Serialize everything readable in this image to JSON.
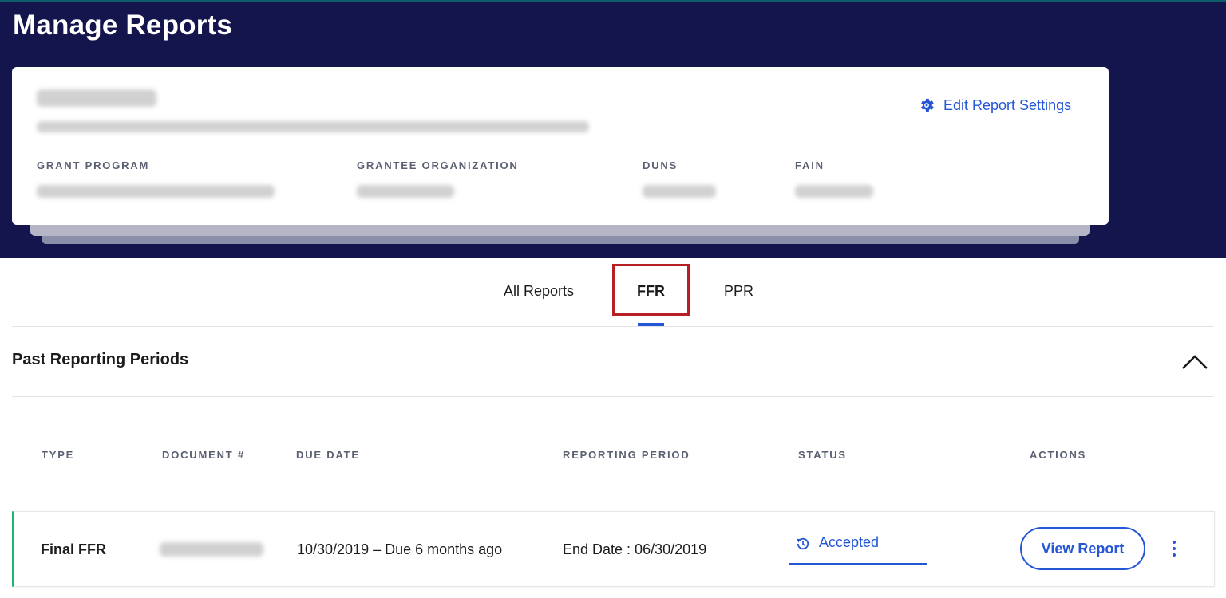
{
  "page": {
    "title": "Manage Reports"
  },
  "grant_card": {
    "edit_settings_label": "Edit Report Settings",
    "fields": [
      {
        "label": "GRANT PROGRAM"
      },
      {
        "label": "GRANTEE ORGANIZATION"
      },
      {
        "label": "DUNS"
      },
      {
        "label": "FAIN"
      }
    ]
  },
  "tabs": [
    {
      "label": "All Reports",
      "active": false
    },
    {
      "label": "FFR",
      "active": true
    },
    {
      "label": "PPR",
      "active": false
    }
  ],
  "section": {
    "title": "Past Reporting Periods",
    "collapse_icon": "chevron-up-icon"
  },
  "table": {
    "columns": [
      "TYPE",
      "DOCUMENT #",
      "DUE DATE",
      "REPORTING PERIOD",
      "STATUS",
      "ACTIONS"
    ],
    "rows": [
      {
        "type": "Final FFR",
        "due_date": "10/30/2019 – Due 6 months ago",
        "reporting_period": "End Date : 06/30/2019",
        "status": "Accepted",
        "status_icon": "history-icon",
        "action_label": "View Report",
        "menu_icon": "kebab-menu-icon"
      }
    ]
  },
  "colors": {
    "hero_bg": "#15154d",
    "accent": "#2456d6",
    "highlight": "#b81f24",
    "row_accent": "#21b46b"
  }
}
